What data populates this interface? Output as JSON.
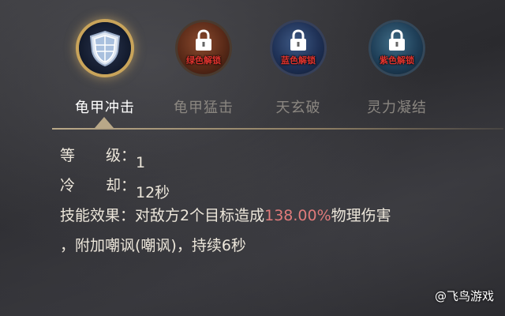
{
  "skills": [
    {
      "name": "龟甲冲击",
      "state": "selected",
      "icon": "shield-icon",
      "unlock_label": ""
    },
    {
      "name": "龟甲猛击",
      "state": "locked",
      "icon": "lock-icon",
      "unlock_label": "绿色解锁"
    },
    {
      "name": "天玄破",
      "state": "locked",
      "icon": "lock-icon",
      "unlock_label": "蓝色解锁"
    },
    {
      "name": "灵力凝结",
      "state": "locked",
      "icon": "lock-icon",
      "unlock_label": "紫色解锁"
    }
  ],
  "details": {
    "level_label_a": "等",
    "level_label_b": "级：",
    "level_value": "1",
    "cooldown_label_a": "冷",
    "cooldown_label_b": "却：",
    "cooldown_value": "12秒",
    "effect_label": "技能效果：",
    "effect_pre": "对敌方2个目标造成",
    "effect_percent": "138.00%",
    "effect_post": "物理伤害",
    "effect_line2": "，附加嘲讽(嘲讽)，持续6秒"
  },
  "watermark": "@飞鸟游戏",
  "colors": {
    "highlight": "#e07b7b",
    "unlock_red": "#e0342e",
    "gold_ring": "#c9a45a"
  }
}
